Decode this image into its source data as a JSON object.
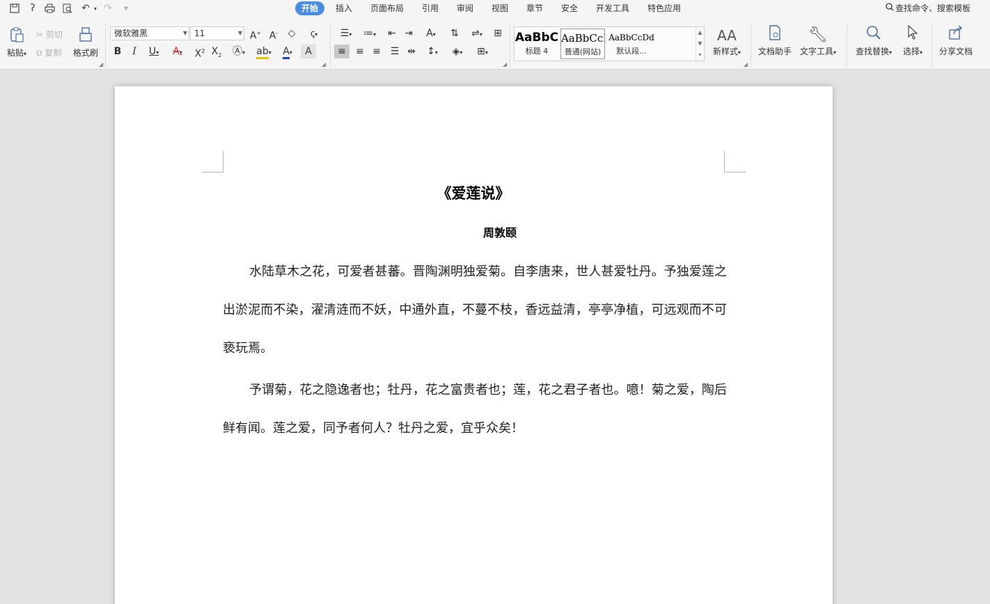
{
  "quick_access": {
    "icons": [
      "save-icon",
      "redo-alt-icon",
      "print-icon",
      "print-preview-icon",
      "undo-icon",
      "redo-icon",
      "customize-icon"
    ]
  },
  "menu_tabs": [
    {
      "label": "开始",
      "active": true
    },
    {
      "label": "插入"
    },
    {
      "label": "页面布局"
    },
    {
      "label": "引用"
    },
    {
      "label": "审阅"
    },
    {
      "label": "视图"
    },
    {
      "label": "章节"
    },
    {
      "label": "安全"
    },
    {
      "label": "开发工具"
    },
    {
      "label": "特色应用"
    }
  ],
  "command_search": {
    "label": "查找命令、搜索模板"
  },
  "ribbon": {
    "paste_label": "粘贴",
    "cut_label": "剪切",
    "copy_label": "复制",
    "format_painter_label": "格式刷",
    "font_name": "微软雅黑",
    "font_size": "11",
    "styles": [
      {
        "sample": "AaBbC",
        "name": "标题 4"
      },
      {
        "sample": "AaBbCcI",
        "name": "普通(网站)",
        "selected": true
      },
      {
        "sample": "AaBbCcDd",
        "name": "默认段..."
      }
    ],
    "new_style_label": "新样式",
    "doc_assistant_label": "文档助手",
    "text_tools_label": "文字工具",
    "find_replace_label": "查找替换",
    "select_label": "选择",
    "share_doc_label": "分享文档"
  },
  "colors": {
    "active_tab": "#4a8de0",
    "font_color_underline": "#1f3fd0",
    "highlight_underline": "#e2c600"
  },
  "document": {
    "title": "《爱莲说》",
    "author": "周敦颐",
    "paragraphs": [
      "水陆草木之花，可爱者甚蕃。晋陶渊明独爱菊。自李唐来，世人甚爱牡丹。予独爱莲之出淤泥而不染，濯清涟而不妖，中通外直，不蔓不枝，香远益清，亭亭净植，可远观而不可亵玩焉。",
      "予谓菊，花之隐逸者也；牡丹，花之富贵者也；莲，花之君子者也。噫！菊之爱，陶后鲜有闻。莲之爱，同予者何人？牡丹之爱，宜乎众矣！"
    ]
  }
}
